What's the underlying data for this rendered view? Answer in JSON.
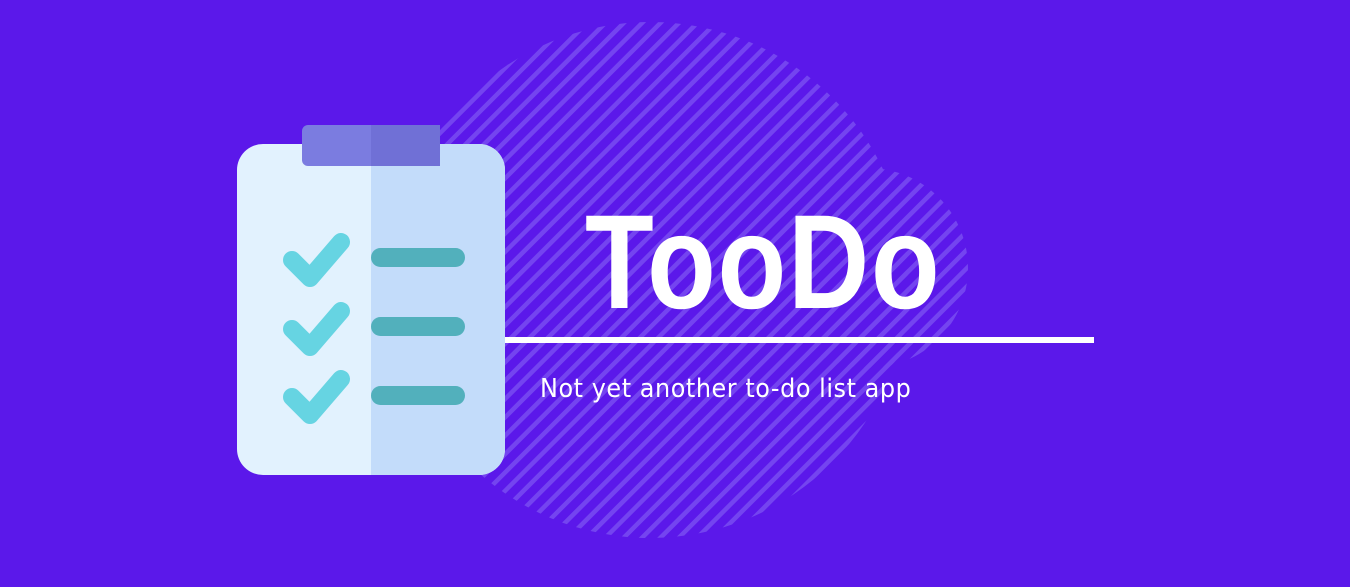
{
  "brand": {
    "title": "TooDo",
    "tagline": "Not yet another to-do list app"
  },
  "icon": {
    "name": "clipboard-checklist-icon",
    "checked_items": 3
  },
  "colors": {
    "background": "#5b18ea",
    "pattern_stripes": "#7444f0",
    "text": "#ffffff",
    "clipboard_light": "#e2f2fe",
    "clipboard_shade": "#c3dcfa",
    "clip": "#7474dc",
    "checkmark": "#66d4e2",
    "item_bar": "#52b0bc"
  }
}
